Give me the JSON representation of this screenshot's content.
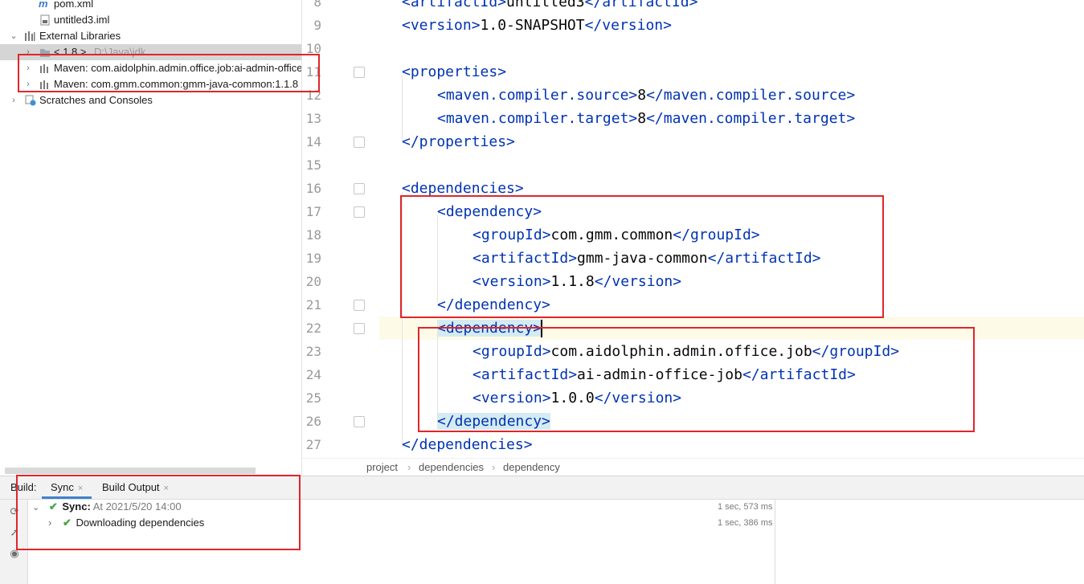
{
  "project_tree": {
    "items": [
      {
        "label": "pom.xml",
        "icon": "maven-file-icon"
      },
      {
        "label": "untitled3.iml",
        "icon": "iml-file-icon"
      },
      {
        "label": "External Libraries",
        "icon": "library-icon"
      },
      {
        "label": "< 1.8 >",
        "suffix": "D:\\Java\\jdk",
        "icon": "jdk-folder-icon"
      },
      {
        "label": "Maven: com.aidolphin.admin.office.job:ai-admin-office",
        "icon": "library-jar-icon"
      },
      {
        "label": "Maven: com.gmm.common:gmm-java-common:1.1.8",
        "icon": "library-jar-icon"
      },
      {
        "label": "Scratches and Consoles",
        "icon": "scratches-icon"
      }
    ]
  },
  "editor": {
    "lines": [
      {
        "n": "8",
        "indent": 1,
        "tokens": [
          [
            "tag",
            "<artifactId>"
          ],
          [
            "txt",
            "untitled3"
          ],
          [
            "tag",
            "</artifactId>"
          ]
        ]
      },
      {
        "n": "9",
        "indent": 1,
        "tokens": [
          [
            "tag",
            "<version>"
          ],
          [
            "txt",
            "1.0-SNAPSHOT"
          ],
          [
            "tag",
            "</version>"
          ]
        ]
      },
      {
        "n": "10",
        "indent": 0,
        "tokens": []
      },
      {
        "n": "11",
        "indent": 1,
        "tokens": [
          [
            "tag",
            "<properties>"
          ]
        ]
      },
      {
        "n": "12",
        "indent": 2,
        "tokens": [
          [
            "tag",
            "<maven.compiler.source>"
          ],
          [
            "txt",
            "8"
          ],
          [
            "tag",
            "</maven.compiler.source>"
          ]
        ]
      },
      {
        "n": "13",
        "indent": 2,
        "tokens": [
          [
            "tag",
            "<maven.compiler.target>"
          ],
          [
            "txt",
            "8"
          ],
          [
            "tag",
            "</maven.compiler.target>"
          ]
        ]
      },
      {
        "n": "14",
        "indent": 1,
        "tokens": [
          [
            "tag",
            "</properties>"
          ]
        ]
      },
      {
        "n": "15",
        "indent": 0,
        "tokens": []
      },
      {
        "n": "16",
        "indent": 1,
        "tokens": [
          [
            "tag",
            "<dependencies>"
          ]
        ]
      },
      {
        "n": "17",
        "indent": 2,
        "tokens": [
          [
            "tag",
            "<dependency>"
          ]
        ]
      },
      {
        "n": "18",
        "indent": 3,
        "tokens": [
          [
            "tag",
            "<groupId>"
          ],
          [
            "txt",
            "com.gmm.common"
          ],
          [
            "tag",
            "</groupId>"
          ]
        ]
      },
      {
        "n": "19",
        "indent": 3,
        "tokens": [
          [
            "tag",
            "<artifactId>"
          ],
          [
            "txt",
            "gmm-java-common"
          ],
          [
            "tag",
            "</artifactId>"
          ]
        ]
      },
      {
        "n": "20",
        "indent": 3,
        "tokens": [
          [
            "tag",
            "<version>"
          ],
          [
            "txt",
            "1.1.8"
          ],
          [
            "tag",
            "</version>"
          ]
        ]
      },
      {
        "n": "21",
        "indent": 2,
        "tokens": [
          [
            "tag",
            "</dependency>"
          ]
        ]
      },
      {
        "n": "22",
        "indent": 2,
        "tokens": [
          [
            "taghl",
            "<dependency>"
          ]
        ]
      },
      {
        "n": "23",
        "indent": 3,
        "tokens": [
          [
            "tag",
            "<groupId>"
          ],
          [
            "txt",
            "com.aidolphin.admin.office.job"
          ],
          [
            "tag",
            "</groupId>"
          ]
        ]
      },
      {
        "n": "24",
        "indent": 3,
        "tokens": [
          [
            "tag",
            "<artifactId>"
          ],
          [
            "txt",
            "ai-admin-office-job"
          ],
          [
            "tag",
            "</artifactId>"
          ]
        ]
      },
      {
        "n": "25",
        "indent": 3,
        "tokens": [
          [
            "tag",
            "<version>"
          ],
          [
            "txt",
            "1.0.0"
          ],
          [
            "tag",
            "</version>"
          ]
        ]
      },
      {
        "n": "26",
        "indent": 2,
        "tokens": [
          [
            "taghl",
            "</dependency>"
          ]
        ]
      },
      {
        "n": "27",
        "indent": 1,
        "tokens": [
          [
            "tag",
            "</dependencies>"
          ]
        ]
      }
    ]
  },
  "breadcrumb": [
    "project",
    "dependencies",
    "dependency"
  ],
  "build": {
    "label": "Build:",
    "tabs": [
      {
        "label": "Sync",
        "close": "×"
      },
      {
        "label": "Build Output",
        "close": "×"
      }
    ],
    "rows": [
      {
        "title": "Sync:",
        "detail": "At 2021/5/20 14:00",
        "duration": "1 sec, 573 ms"
      },
      {
        "title": "Downloading dependencies",
        "detail": "",
        "duration": "1 sec, 386 ms"
      }
    ]
  },
  "colors": {
    "tag": "#0033b3",
    "text": "#080808",
    "highlight_box": "#e0262b",
    "caret_line": "#fdfbe8"
  }
}
